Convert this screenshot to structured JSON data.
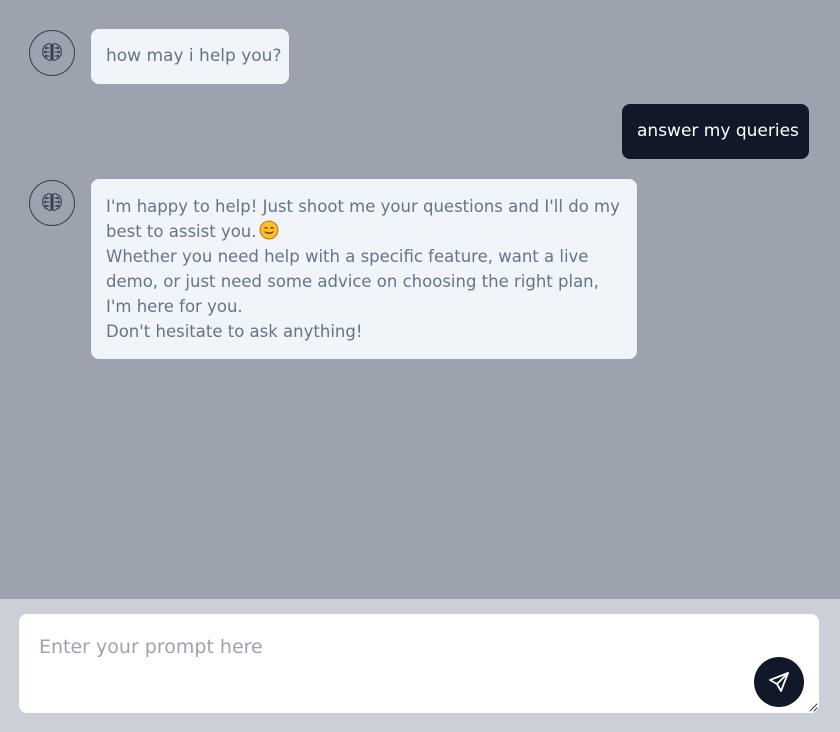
{
  "messages": [
    {
      "role": "bot",
      "avatar_icon": "brain-icon",
      "text": "how may i help you?"
    },
    {
      "role": "user",
      "text": "answer my queries"
    },
    {
      "role": "bot",
      "avatar_icon": "brain-icon",
      "lines": [
        "I'm happy to help! Just shoot me your questions and I'll do my",
        "best to assist you.",
        "Whether you need help with a specific feature, want a live",
        "demo, or just need some advice on choosing the right plan,",
        "I'm here for you.",
        "Don't hesitate to ask anything!"
      ],
      "emoji": "smiling-face-emoji"
    }
  ],
  "composer": {
    "placeholder": "Enter your prompt here",
    "value": "",
    "send_icon": "send-icon"
  },
  "colors": {
    "chat_background": "#9ca3af",
    "composer_background": "#cbd0d8",
    "bot_bubble": "#f1f5f9",
    "bot_text": "#64748b",
    "user_bubble": "#111827",
    "user_text": "#ffffff",
    "send_button": "#111827"
  }
}
